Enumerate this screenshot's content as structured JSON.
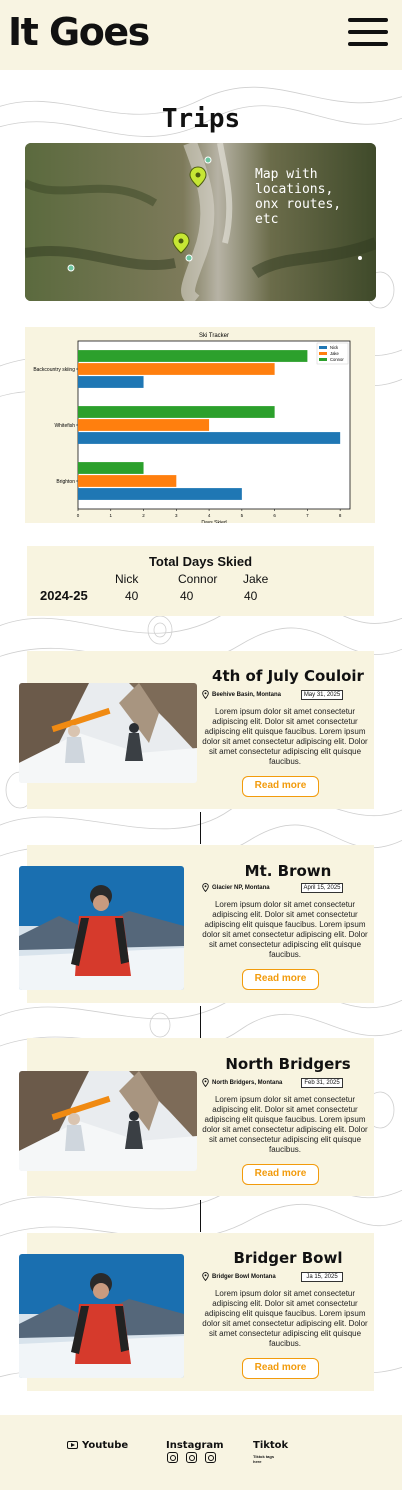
{
  "header": {
    "logo": "It Goes"
  },
  "page": {
    "title": "Trips"
  },
  "map": {
    "caption": "Map with\nlocations,\nonx routes,\netc"
  },
  "chart_data": {
    "type": "bar",
    "orientation": "horizontal",
    "title": "Ski Tracker",
    "xlabel": "Days Skied",
    "ylabel": "",
    "categories": [
      "Brighton",
      "Whitefish",
      "Backcountry skiing"
    ],
    "series": [
      {
        "name": "Nick",
        "values": [
          5,
          8,
          2
        ],
        "color": "#1f77b4"
      },
      {
        "name": "Jake",
        "values": [
          3,
          4,
          6
        ],
        "color": "#ff7f0e"
      },
      {
        "name": "Connor",
        "values": [
          2,
          6,
          7
        ],
        "color": "#2ca02c"
      }
    ],
    "xlim": [
      0,
      8.3
    ],
    "xticks": [
      "0",
      "1",
      "2",
      "3",
      "4",
      "5",
      "6",
      "7",
      "8"
    ],
    "legend": "top-right",
    "grid": false
  },
  "stats": {
    "title": "Total Days Skied",
    "columns": [
      "Nick",
      "Connor",
      "Jake"
    ],
    "row_label": "2024-25",
    "values": [
      "40",
      "40",
      "40"
    ]
  },
  "trips": [
    {
      "title": "4th of July Couloir",
      "location": "Beehive Basin, Montana",
      "date": "May 31, 2025",
      "body": "Lorem ipsum dolor sit amet consectetur adipiscing elit. Dolor sit amet consectetur adipiscing elit quisque faucibus. Lorem ipsum dolor sit amet consectetur adipiscing elit. Dolor sit amet consectetur adipiscing elit quisque faucibus.",
      "button": "Read more"
    },
    {
      "title": "Mt. Brown",
      "location": "Glacier NP, Montana",
      "date": "April 15, 2025",
      "body": "Lorem ipsum dolor sit amet consectetur adipiscing elit. Dolor sit amet consectetur adipiscing elit quisque faucibus. Lorem ipsum dolor sit amet consectetur adipiscing elit. Dolor sit amet consectetur adipiscing elit quisque faucibus.",
      "button": "Read more"
    },
    {
      "title": "North Bridgers",
      "location": "North Bridgers, Montana",
      "date": "Feb 31, 2025",
      "body": "Lorem ipsum dolor sit amet consectetur adipiscing elit. Dolor sit amet consectetur adipiscing elit quisque faucibus. Lorem ipsum dolor sit amet consectetur adipiscing elit. Dolor sit amet consectetur adipiscing elit quisque faucibus.",
      "button": "Read more"
    },
    {
      "title": "Bridger Bowl",
      "location": "Bridger Bowl Montana",
      "date": "Ja 15, 2025",
      "body": "Lorem ipsum dolor sit amet consectetur adipiscing elit. Dolor sit amet consectetur adipiscing elit quisque faucibus. Lorem ipsum dolor sit amet consectetur adipiscing elit. Dolor sit amet consectetur adipiscing elit quisque faucibus.",
      "button": "Read more"
    }
  ],
  "footer": {
    "youtube": "Youtube",
    "instagram": "Instagram",
    "tiktok": "Tiktok",
    "tiktok_tag": "Tiktok tags here"
  },
  "colors": {
    "accent": "#f29b0c",
    "card": "#f8f4e0",
    "header": "#f8f4e2"
  }
}
